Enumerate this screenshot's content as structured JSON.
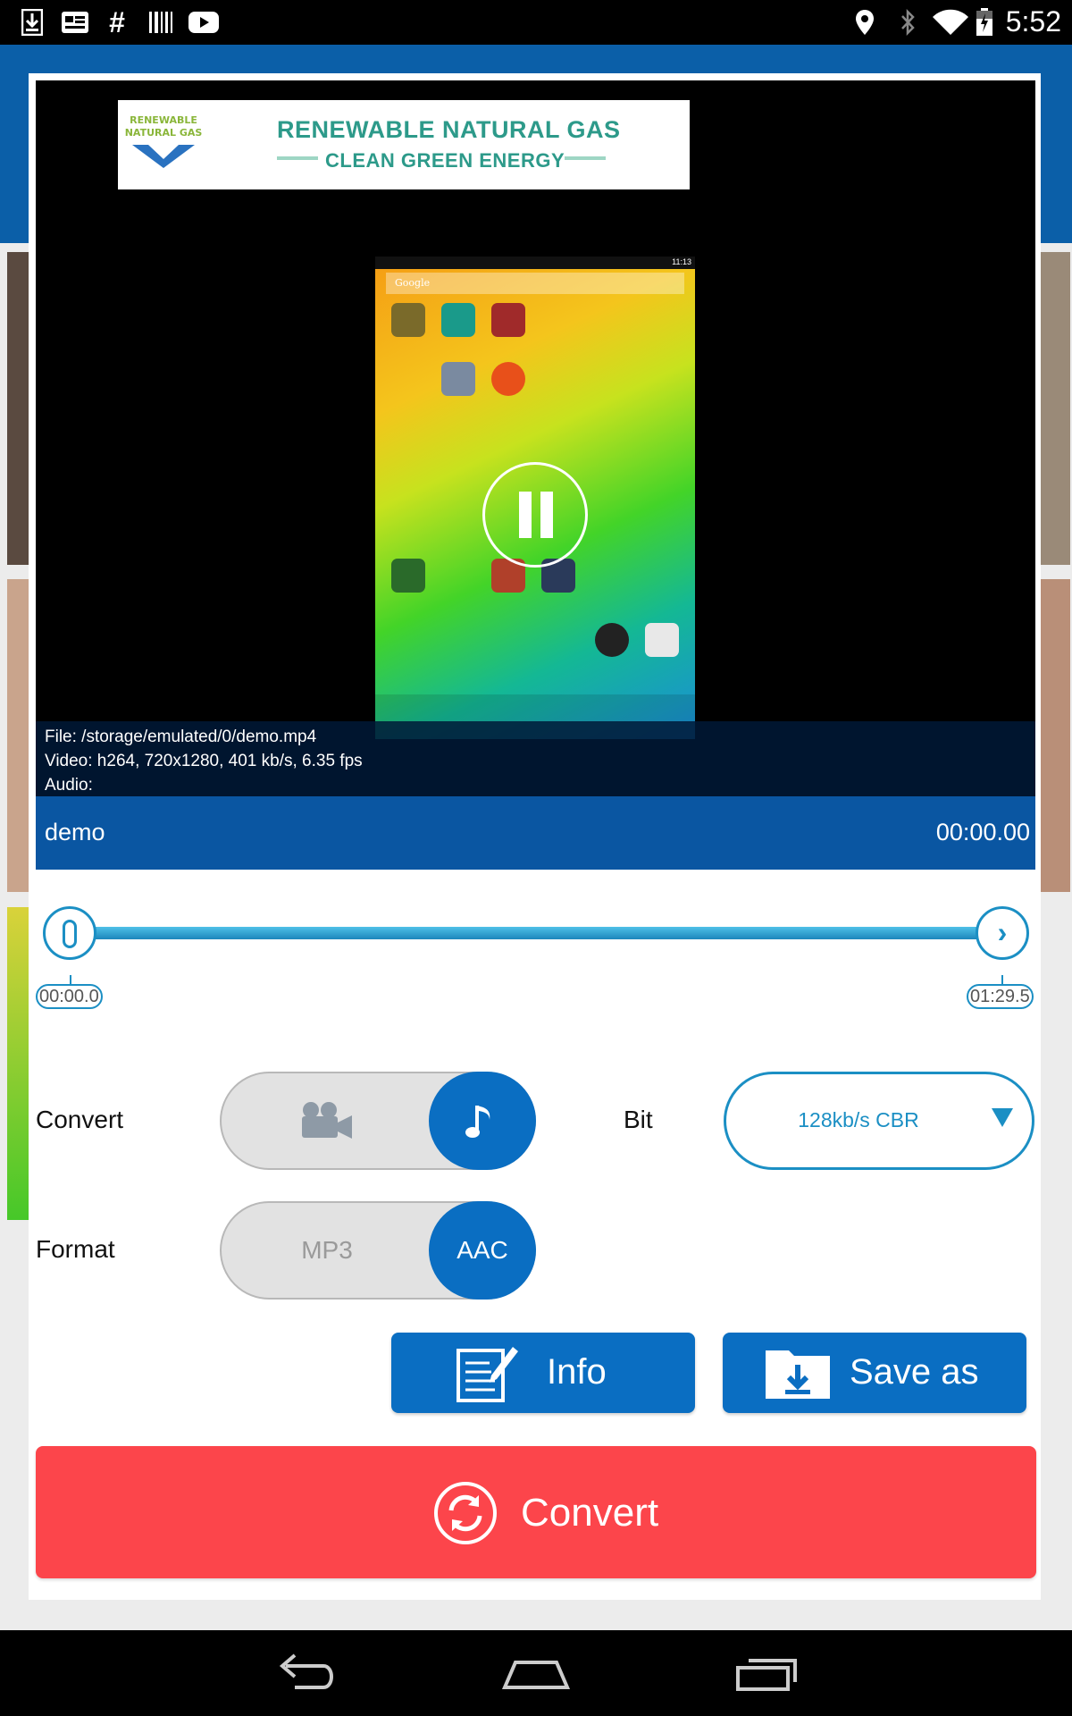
{
  "status_bar": {
    "time": "5:52",
    "left_icons": [
      "download-icon",
      "news-icon",
      "hashtag-icon",
      "barcode-icon",
      "youtube-icon"
    ],
    "right_icons": [
      "location-icon",
      "bluetooth-icon",
      "wifi-icon",
      "battery-icon"
    ]
  },
  "ad": {
    "logo_text": "RENEWABLE NATURAL GAS",
    "line1": "RENEWABLE NATURAL GAS",
    "line2": "CLEAN GREEN ENERGY"
  },
  "preview": {
    "search_hint": "Google",
    "clock": "11:13"
  },
  "file_info": {
    "file": "File: /storage/emulated/0/demo.mp4",
    "video": "Video: h264, 720x1280,  401 kb/s,  6.35 fps",
    "audio": "Audio:"
  },
  "player": {
    "title": "demo",
    "position": "00:00.00",
    "state": "playing"
  },
  "trim": {
    "start": "00:00.0",
    "end": "01:29.5"
  },
  "options": {
    "convert_label": "Convert",
    "convert_selected": "audio",
    "bit_label": "Bit",
    "bit_value": "128kb/s CBR",
    "format_label": "Format",
    "format_off": "MP3",
    "format_on": "AAC"
  },
  "actions": {
    "info": "Info",
    "save_as": "Save as",
    "convert": "Convert"
  },
  "colors": {
    "accent": "#0a6ec2",
    "header": "#0a56a2",
    "convert": "#fc454b"
  }
}
